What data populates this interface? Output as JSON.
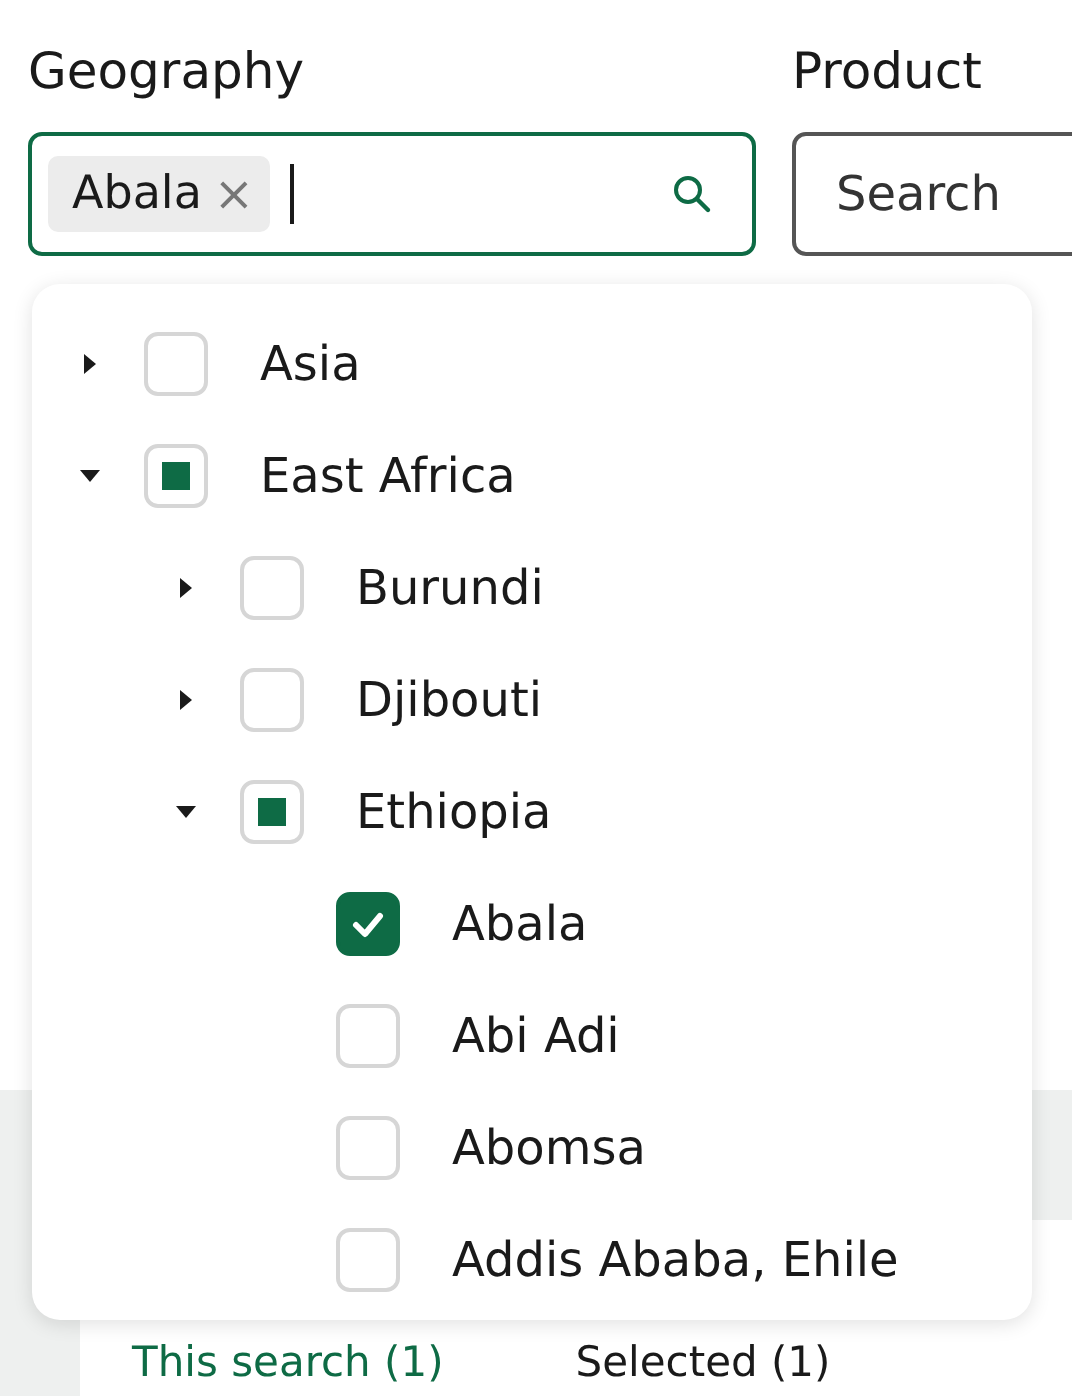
{
  "filters": [
    {
      "label": "Geography",
      "chips": [
        {
          "label": "Abala",
          "remove": "×"
        }
      ],
      "focused": true
    },
    {
      "label": "Product",
      "placeholder": "Search",
      "focused": false
    }
  ],
  "dropdown": {
    "nodes": [
      {
        "kind": "group",
        "label": "Asia",
        "checked": false,
        "partial": false,
        "expanded": false
      },
      {
        "kind": "group",
        "label": "East Africa",
        "checked": false,
        "partial": true,
        "expanded": true,
        "children": [
          {
            "kind": "group",
            "label": "Burundi",
            "checked": false,
            "partial": false,
            "expanded": false
          },
          {
            "kind": "group",
            "label": "Djibouti",
            "checked": false,
            "partial": false,
            "expanded": false
          },
          {
            "kind": "group",
            "label": "Ethiopia",
            "checked": false,
            "partial": true,
            "expanded": true,
            "children": [
              {
                "kind": "item",
                "label": "Abala",
                "checked": true
              },
              {
                "kind": "item",
                "label": "Abi Adi",
                "checked": false
              },
              {
                "kind": "item",
                "label": "Abomsa",
                "checked": false
              },
              {
                "kind": "item",
                "label": "Addis Ababa, Ehile",
                "checked": false
              }
            ]
          }
        ]
      }
    ]
  },
  "results_tabs": [
    {
      "label": "This search (1)",
      "selected": true
    },
    {
      "label": "Selected (1)",
      "selected": false
    }
  ]
}
